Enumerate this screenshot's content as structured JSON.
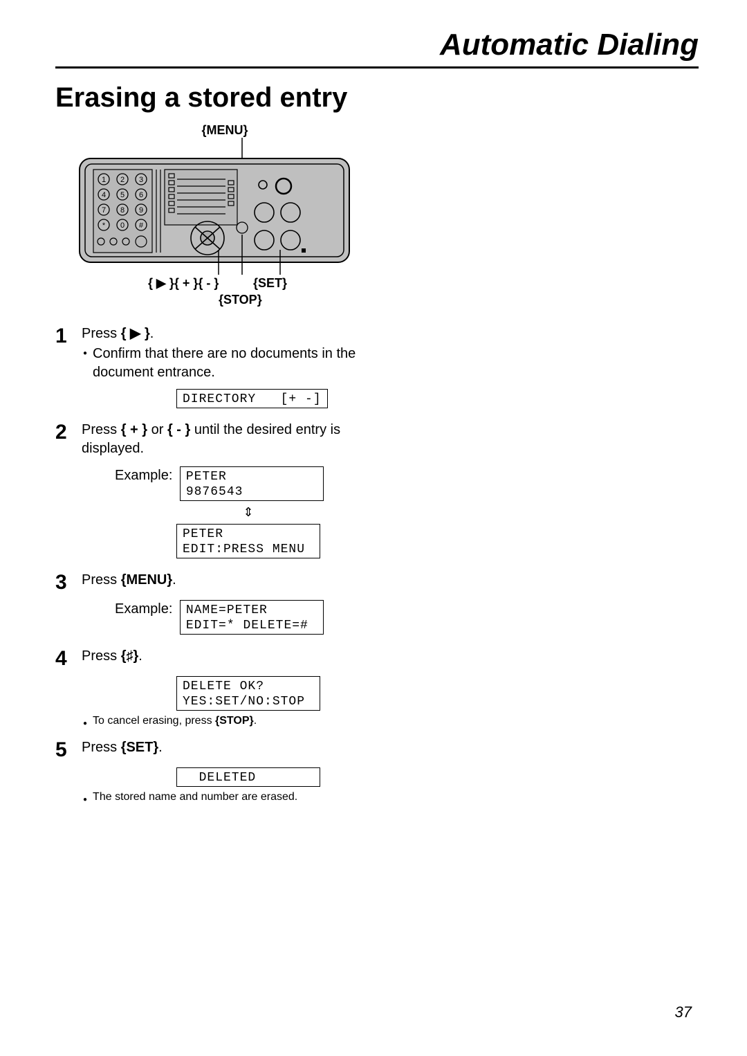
{
  "header": {
    "doc_title": "Automatic Dialing",
    "section_title": "Erasing a stored entry"
  },
  "diagram": {
    "top_label": "{MENU}",
    "nav_label": "{ ▶ }{ + }{ - }",
    "set_label": "{SET}",
    "stop_label": "{STOP}",
    "keypad_star": "*",
    "keypad_zero": "0",
    "keypad_hash": "#"
  },
  "steps": {
    "s1": {
      "num": "1",
      "press_prefix": "Press ",
      "press_key": "{ ▶ }",
      "press_suffix": ".",
      "bullet": "Confirm that there are no documents in the document entrance.",
      "lcd": "DIRECTORY   [+ -]"
    },
    "s2": {
      "num": "2",
      "press_prefix": "Press ",
      "press_key_a": "{ + }",
      "press_mid": " or ",
      "press_key_b": "{ - }",
      "press_suffix": " until the desired entry is displayed.",
      "example_label": "Example:",
      "lcd_a": "PETER\n9876543",
      "arrow": "⇕",
      "lcd_b": "PETER\nEDIT:PRESS MENU"
    },
    "s3": {
      "num": "3",
      "press_prefix": "Press ",
      "press_key": "{MENU}",
      "press_suffix": ".",
      "example_label": "Example:",
      "lcd": "NAME=PETER\nEDIT=* DELETE=#"
    },
    "s4": {
      "num": "4",
      "press_prefix": "Press ",
      "press_key": "{♯}",
      "press_suffix": ".",
      "lcd": "DELETE OK?\nYES:SET/NO:STOP",
      "bullet_pre": "To cancel erasing, press ",
      "bullet_key": "{STOP}",
      "bullet_post": "."
    },
    "s5": {
      "num": "5",
      "press_prefix": "Press ",
      "press_key": "{SET}",
      "press_suffix": ".",
      "lcd": "  DELETED",
      "bullet": "The stored name and number are erased."
    }
  },
  "footer": {
    "page_number": "37"
  }
}
